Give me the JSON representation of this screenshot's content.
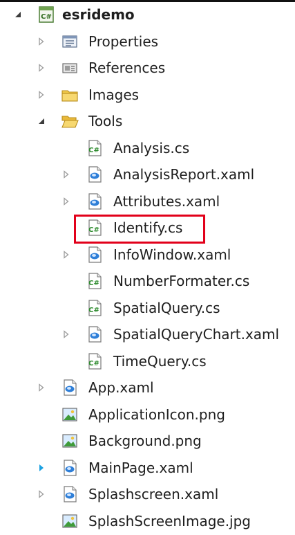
{
  "colors": {
    "text": "#1e1e1e",
    "arrow_collapsed": "#9b9b9b",
    "arrow_expanded": "#3c3c3c",
    "arrow_selected": "#1ba1e2",
    "highlight": "#e2001a"
  },
  "tree": {
    "root": {
      "label": "esridemo",
      "icon": "csharp-project-icon",
      "state": "expanded"
    },
    "items": [
      {
        "label": "Properties",
        "icon": "properties-icon",
        "state": "collapsed",
        "level": 1
      },
      {
        "label": "References",
        "icon": "references-icon",
        "state": "collapsed",
        "level": 1
      },
      {
        "label": "Images",
        "icon": "folder-closed-icon",
        "state": "collapsed",
        "level": 1
      },
      {
        "label": "Tools",
        "icon": "folder-open-icon",
        "state": "expanded",
        "level": 1
      },
      {
        "label": "Analysis.cs",
        "icon": "csharp-file-icon",
        "state": "leaf",
        "level": 2
      },
      {
        "label": "AnalysisReport.xaml",
        "icon": "xaml-file-icon",
        "state": "collapsed",
        "level": 2
      },
      {
        "label": "Attributes.xaml",
        "icon": "xaml-file-icon",
        "state": "collapsed",
        "level": 2
      },
      {
        "label": "Identify.cs",
        "icon": "csharp-file-icon",
        "state": "leaf",
        "level": 2,
        "highlighted": true
      },
      {
        "label": "InfoWindow.xaml",
        "icon": "xaml-file-icon",
        "state": "collapsed",
        "level": 2
      },
      {
        "label": "NumberFormater.cs",
        "icon": "csharp-file-icon",
        "state": "leaf",
        "level": 2
      },
      {
        "label": "SpatialQuery.cs",
        "icon": "csharp-file-icon",
        "state": "leaf",
        "level": 2
      },
      {
        "label": "SpatialQueryChart.xaml",
        "icon": "xaml-file-icon",
        "state": "collapsed",
        "level": 2
      },
      {
        "label": "TimeQuery.cs",
        "icon": "csharp-file-icon",
        "state": "leaf",
        "level": 2
      },
      {
        "label": "App.xaml",
        "icon": "xaml-file-icon",
        "state": "collapsed",
        "level": 1
      },
      {
        "label": "ApplicationIcon.png",
        "icon": "image-file-icon",
        "state": "leaf",
        "level": 1
      },
      {
        "label": "Background.png",
        "icon": "image-file-icon",
        "state": "leaf",
        "level": 1
      },
      {
        "label": "MainPage.xaml",
        "icon": "xaml-file-icon",
        "state": "collapsed-selected",
        "level": 1
      },
      {
        "label": "Splashscreen.xaml",
        "icon": "xaml-file-icon",
        "state": "collapsed",
        "level": 1
      },
      {
        "label": "SplashScreenImage.jpg",
        "icon": "image-file-icon",
        "state": "leaf",
        "level": 1
      }
    ]
  }
}
